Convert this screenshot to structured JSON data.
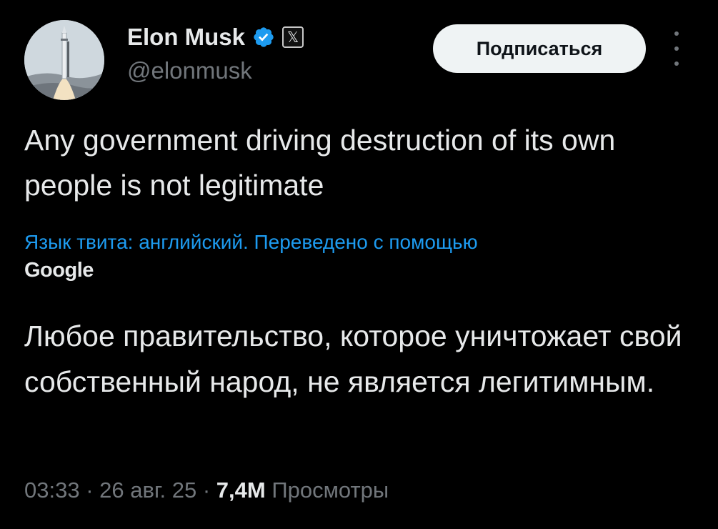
{
  "author": {
    "display_name": "Elon Musk",
    "handle": "@elonmusk",
    "verified_icon": "verified-badge-icon",
    "affiliate_icon": "x-logo-icon",
    "affiliate_glyph": "𝕏"
  },
  "header": {
    "follow_label": "Подписаться"
  },
  "tweet": {
    "text": "Any government driving destruction of its own people is not legitimate",
    "translation_note": "Язык твита: английский. Переведено с помощью",
    "translator": "Google",
    "translated_text": "Любое правительство, которое уничтожает свой собственный народ, не является легитимным."
  },
  "meta": {
    "time": "03:33",
    "separator": "·",
    "date": "26 авг. 25",
    "views_count": "7,4M",
    "views_label": "Просмотры"
  },
  "colors": {
    "background": "#000000",
    "text": "#e7e9ea",
    "muted": "#71767b",
    "link": "#1d9bf0",
    "verified": "#1d9bf0",
    "button_bg": "#eff3f4"
  }
}
